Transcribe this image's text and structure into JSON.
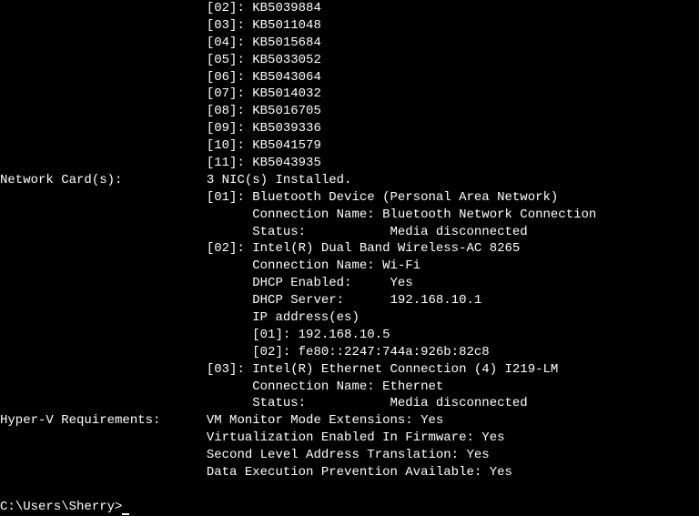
{
  "hotfixes": [
    {
      "idx": "[02]",
      "kb": "KB5039884"
    },
    {
      "idx": "[03]",
      "kb": "KB5011048"
    },
    {
      "idx": "[04]",
      "kb": "KB5015684"
    },
    {
      "idx": "[05]",
      "kb": "KB5033052"
    },
    {
      "idx": "[06]",
      "kb": "KB5043064"
    },
    {
      "idx": "[07]",
      "kb": "KB5014032"
    },
    {
      "idx": "[08]",
      "kb": "KB5016705"
    },
    {
      "idx": "[09]",
      "kb": "KB5039336"
    },
    {
      "idx": "[10]",
      "kb": "KB5041579"
    },
    {
      "idx": "[11]",
      "kb": "KB5043935"
    }
  ],
  "network_cards": {
    "label": "Network Card(s):",
    "summary": "3 NIC(s) Installed.",
    "nics": [
      {
        "idx": "[01]:",
        "name": "Bluetooth Device (Personal Area Network)",
        "conn_label": "Connection Name:",
        "conn_value": "Bluetooth Network Connection",
        "status_label": "Status:",
        "status_value": "Media disconnected"
      },
      {
        "idx": "[02]:",
        "name": "Intel(R) Dual Band Wireless-AC 8265",
        "conn_label": "Connection Name:",
        "conn_value": "Wi-Fi",
        "dhcp_enabled_label": "DHCP Enabled:",
        "dhcp_enabled_value": "Yes",
        "dhcp_server_label": "DHCP Server:",
        "dhcp_server_value": "192.168.10.1",
        "ip_label": "IP address(es)",
        "ips": [
          {
            "idx": "[01]:",
            "addr": "192.168.10.5"
          },
          {
            "idx": "[02]:",
            "addr": "fe80::2247:744a:926b:82c8"
          }
        ]
      },
      {
        "idx": "[03]:",
        "name": "Intel(R) Ethernet Connection (4) I219-LM",
        "conn_label": "Connection Name:",
        "conn_value": "Ethernet",
        "status_label": "Status:",
        "status_value": "Media disconnected"
      }
    ]
  },
  "hyperv": {
    "label": "Hyper-V Requirements:",
    "lines": [
      "VM Monitor Mode Extensions: Yes",
      "Virtualization Enabled In Firmware: Yes",
      "Second Level Address Translation: Yes",
      "Data Execution Prevention Available: Yes"
    ]
  },
  "prompt": "C:\\Users\\Sherry>",
  "indent": {
    "col_label": 0,
    "col_value": 27,
    "col_sub": 33,
    "col_sub2": 51
  }
}
